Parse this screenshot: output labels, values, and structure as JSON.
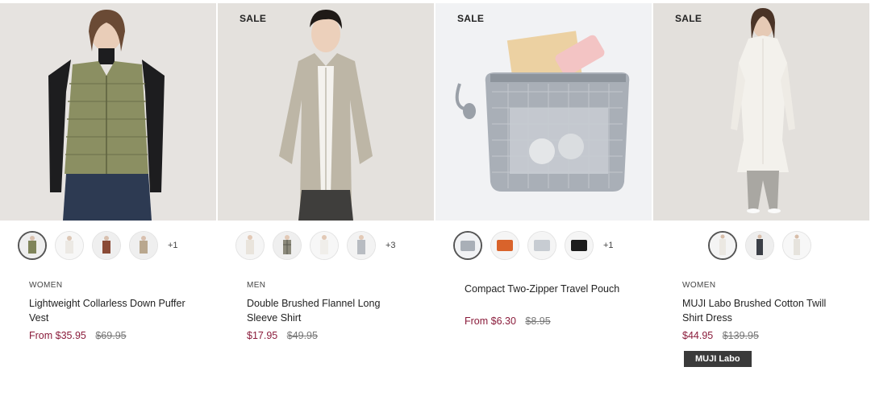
{
  "products": [
    {
      "sale": "",
      "category": "WOMEN",
      "title": "Lightweight Collarless Down Puffer Vest",
      "price": "From $35.95",
      "original_price": "$69.95",
      "more_colors": "+1",
      "badge": ""
    },
    {
      "sale": "SALE",
      "category": "MEN",
      "title": "Double Brushed Flannel Long Sleeve Shirt",
      "price": "$17.95",
      "original_price": "$49.95",
      "more_colors": "+3",
      "badge": ""
    },
    {
      "sale": "SALE",
      "category": "",
      "title": "Compact Two-Zipper Travel Pouch",
      "price": "From $6.30",
      "original_price": "$8.95",
      "more_colors": "+1",
      "badge": ""
    },
    {
      "sale": "SALE",
      "category": "WOMEN",
      "title": "MUJI Labo Brushed Cotton Twill Shirt Dress",
      "price": "$44.95",
      "original_price": "$139.95",
      "more_colors": "",
      "badge": "MUJI Labo"
    }
  ],
  "colors": {
    "price": "#8a1c3b",
    "badge_bg": "#3a3a3a"
  }
}
